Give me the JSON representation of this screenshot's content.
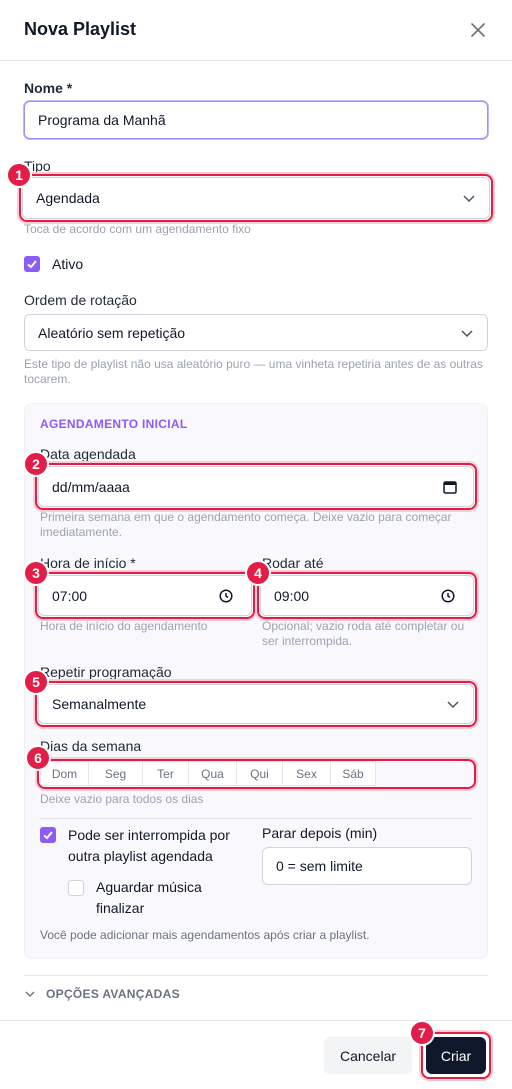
{
  "dialog": {
    "title": "Nova Playlist"
  },
  "name": {
    "label": "Nome *",
    "value": "Programa da Manhã"
  },
  "type": {
    "label": "Tipo",
    "value": "Agendada",
    "help": "Toca de acordo com um agendamento fixo"
  },
  "active": {
    "label": "Ativo",
    "checked": true
  },
  "rotation": {
    "label": "Ordem de rotação",
    "value": "Aleatório sem repetição",
    "help": "Este tipo de playlist não usa aleatório puro — uma vinheta repetiria antes de as outras tocarem."
  },
  "schedule": {
    "section_title": "AGENDAMENTO INICIAL",
    "date_label": "Data agendada",
    "date_value": "dd/mm/aaaa",
    "date_help": "Primeira semana em que o agendamento começa. Deixe vazio para começar imediatamente.",
    "start_label": "Hora de início *",
    "start_value": "07:00",
    "start_help": "Hora de início do agendamento",
    "until_label": "Rodar até",
    "until_value": "09:00",
    "until_help": "Opcional; vazio roda até completar ou ser interrompida.",
    "repeat_label": "Repetir programação",
    "repeat_value": "Semanalmente",
    "weekdays_label": "Dias da semana",
    "weekdays": [
      "Dom",
      "Seg",
      "Ter",
      "Qua",
      "Qui",
      "Sex",
      "Sáb"
    ],
    "weekdays_help": "Deixe vazio para todos os dias",
    "interruptible_label": "Pode ser interrompida por outra playlist agendada",
    "interruptible_checked": true,
    "wait_label": "Aguardar música finalizar",
    "wait_checked": false,
    "stop_after_label": "Parar depois (min)",
    "stop_after_placeholder": "0 = sem limite",
    "note": "Você pode adicionar mais agendamentos após criar a playlist."
  },
  "advanced": {
    "label": "OPÇÕES AVANÇADAS"
  },
  "footer": {
    "cancel_label": "Cancelar",
    "create_label": "Criar"
  },
  "highlights": [
    "1",
    "2",
    "3",
    "4",
    "5",
    "6",
    "7"
  ],
  "colors": {
    "accent": "#8b5cf6",
    "highlight": "#e11d48",
    "primary_button": "#0f172a"
  }
}
